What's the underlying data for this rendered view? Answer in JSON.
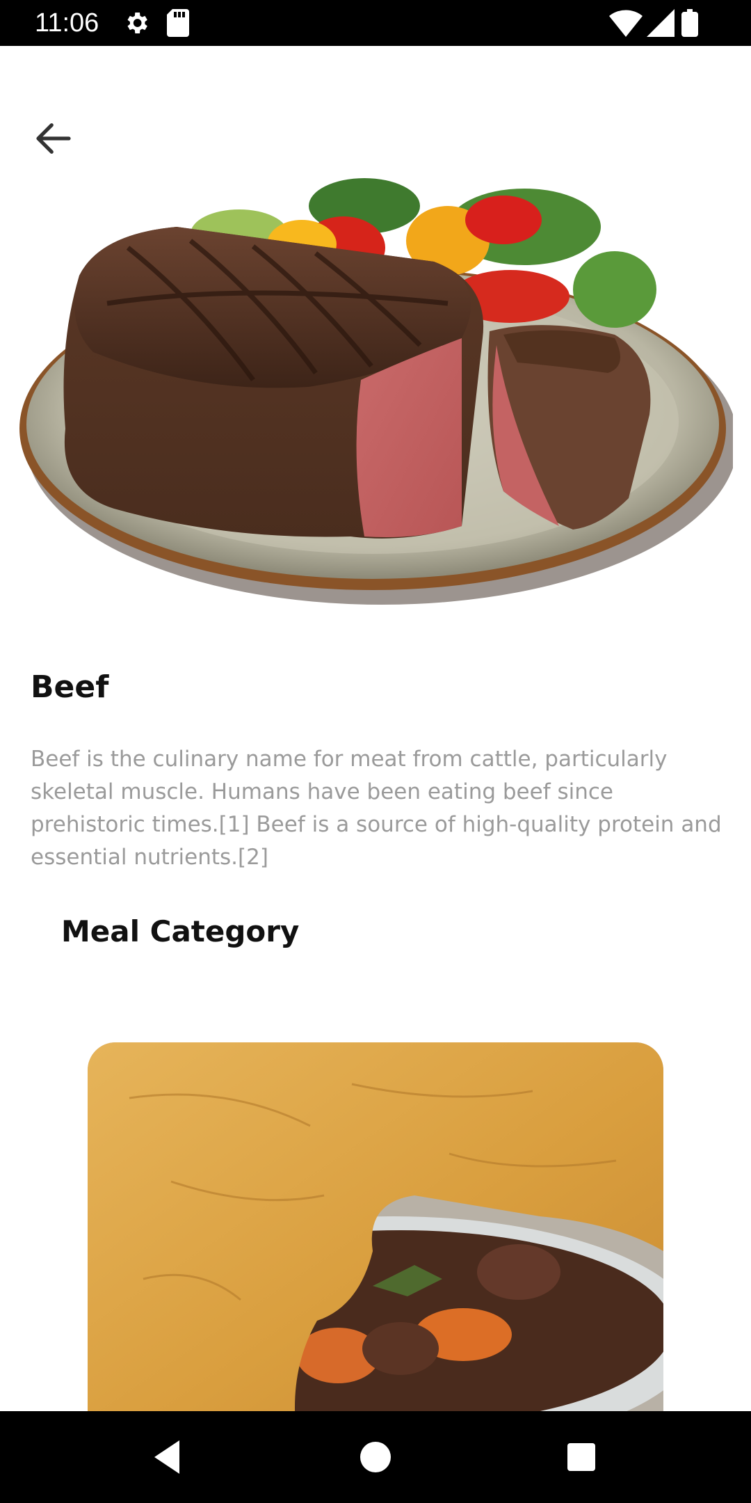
{
  "status_bar": {
    "time": "11:06",
    "icons": [
      "gear-icon",
      "sd-card-icon",
      "wifi-icon",
      "signal-icon",
      "battery-icon"
    ]
  },
  "header": {
    "back_icon": "arrow-left-icon"
  },
  "detail": {
    "title": "Beef",
    "description": "Beef is the culinary name for meat from cattle, particularly skeletal muscle. Humans have been eating beef since prehistoric times.[1] Beef is a source of high-quality protein and essential nutrients.[2]"
  },
  "meal_category": {
    "heading": "Meal Category"
  },
  "nav_bar": {
    "icons": [
      "back-triangle-icon",
      "home-circle-icon",
      "recents-square-icon"
    ]
  },
  "colors": {
    "status_bg": "#000000",
    "description_text": "#9a9a9a",
    "title_text": "#111111"
  }
}
